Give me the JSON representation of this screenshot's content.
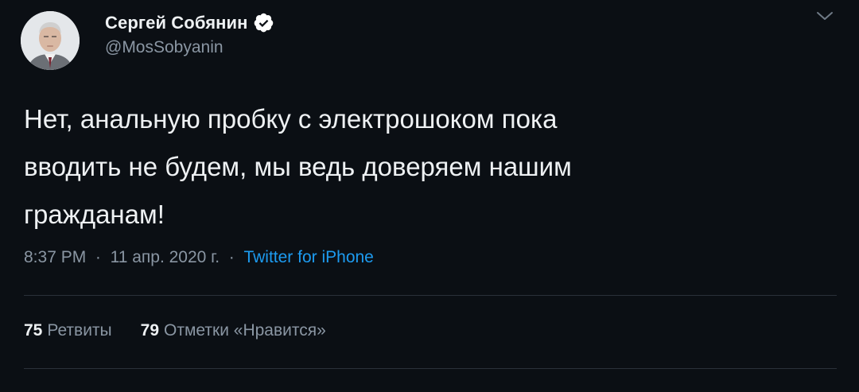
{
  "author": {
    "display_name": "Сергей Собянин",
    "handle": "@MosSobyanin",
    "verified": true,
    "verified_color": "#ffffff"
  },
  "tweet": {
    "lines": [
      "Нет, анальную пробку с электрошоком пока",
      "вводить не будем, мы ведь доверяем нашим",
      "гражданам!"
    ]
  },
  "meta": {
    "time": "8:37 PM",
    "separator": "·",
    "date": "11 апр. 2020 г.",
    "source": "Twitter for iPhone",
    "source_color": "#1d9bf0"
  },
  "stats": {
    "retweets_count": "75",
    "retweets_label": "Ретвиты",
    "likes_count": "79",
    "likes_label": "Отметки «Нравится»"
  },
  "icons": {
    "verified": "verified-badge-icon",
    "menu": "chevron-down-icon",
    "avatar": "profile-photo"
  },
  "colors": {
    "background": "#0b0f14",
    "text": "#eef1f3",
    "muted": "#8a96a3"
  }
}
